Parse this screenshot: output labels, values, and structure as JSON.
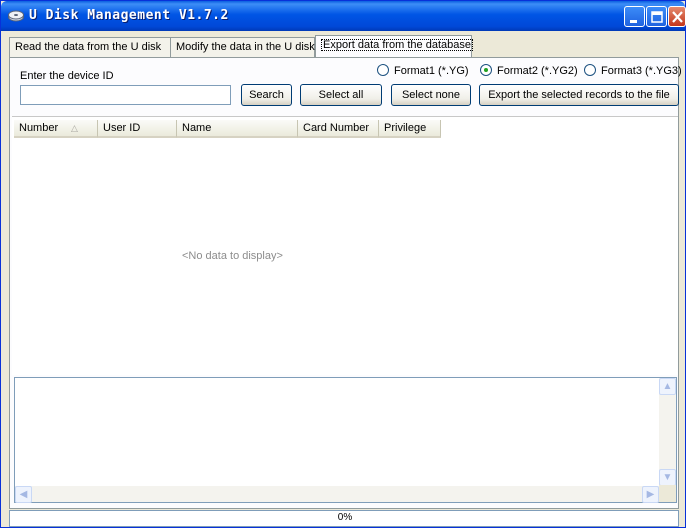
{
  "window": {
    "title": "U Disk Management V1.7.2"
  },
  "tabs": [
    {
      "label": "Read the data from the U disk",
      "active": false
    },
    {
      "label": "Modify the data in the U disk",
      "active": false
    },
    {
      "label": "Export data from the database",
      "active": true
    }
  ],
  "export": {
    "device_label": "Enter the device ID",
    "device_value": "",
    "search_label": "Search",
    "select_all_label": "Select all",
    "select_none_label": "Select none",
    "export_label": "Export the selected records to the file",
    "formats": [
      {
        "label": "Format1 (*.YG)",
        "selected": false
      },
      {
        "label": "Format2 (*.YG2)",
        "selected": true
      },
      {
        "label": "Format3 (*.YG3)",
        "selected": false
      }
    ]
  },
  "grid": {
    "columns": [
      "Number",
      "User ID",
      "Name",
      "Card Number",
      "Privilege"
    ],
    "sort_column": "Number",
    "empty_text": "<No data to display>"
  },
  "log": {
    "text": ""
  },
  "status": {
    "progress": "0%",
    "progress_fraction": 0
  },
  "colors": {
    "title_bar": "#0055e5",
    "window_face": "#ece9d8",
    "tab_border": "#919b9c",
    "radio_dot": "#21a121"
  }
}
